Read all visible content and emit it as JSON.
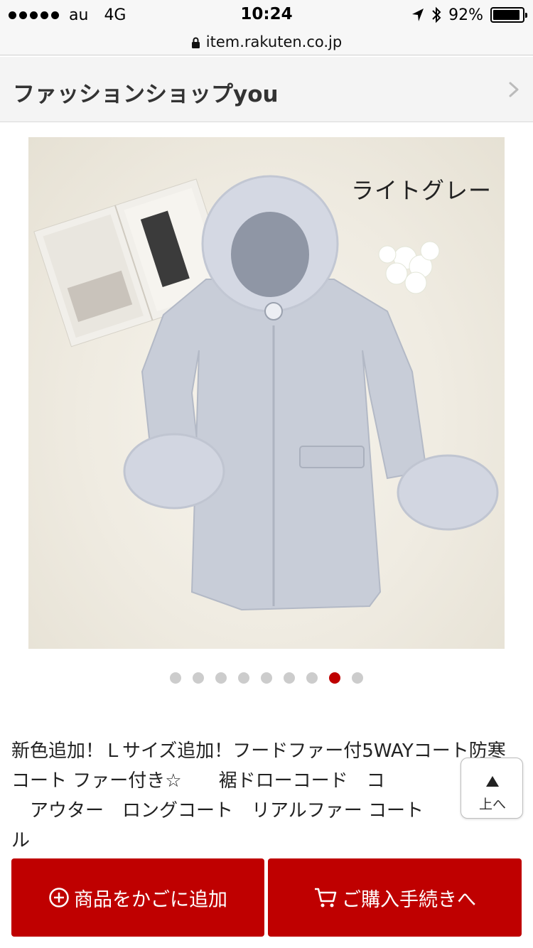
{
  "status_bar": {
    "carrier": "au",
    "network": "4G",
    "time": "10:24",
    "battery": "92%",
    "battery_level": 0.92,
    "icons": [
      "signal-dots-icon",
      "location-arrow-icon",
      "bluetooth-icon",
      "battery-icon"
    ]
  },
  "url_bar": {
    "url": "item.rakuten.co.jp",
    "icon": "lock-icon"
  },
  "shop": {
    "name": "ファッションショップyou",
    "icon": "chevron-right-icon"
  },
  "product_image": {
    "label": "ライトグレー"
  },
  "carousel": {
    "count": 9,
    "active_index": 7
  },
  "product": {
    "title": "新色追加！Ｌサイズ追加！フードファー付5WAYコート防寒 コート ファー付き☆　　裾ドローコード　コ\n　アウター　ロングコート　リアルファー コート　\nル"
  },
  "to_top": {
    "label": "上へ",
    "icon": "arrow-up-icon"
  },
  "actions": {
    "add_to_cart": "商品をかごに追加",
    "checkout": "ご購入手続きへ"
  },
  "colors": {
    "accent": "#bf0000",
    "dot_inactive": "#cccccc"
  }
}
